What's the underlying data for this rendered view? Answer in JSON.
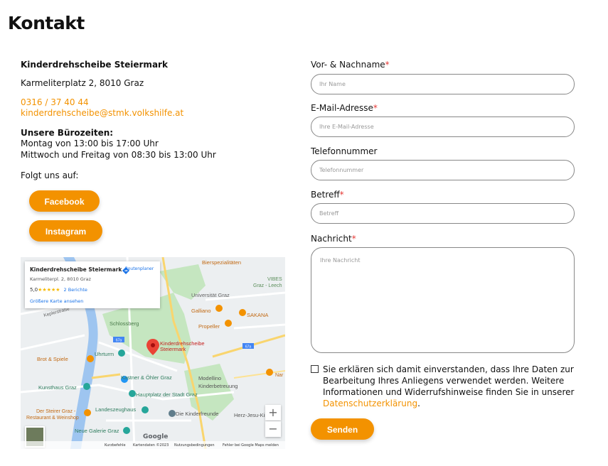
{
  "page": {
    "title": "Kontakt"
  },
  "contact": {
    "org": "Kinderdrehscheibe Steiermark",
    "address": "Karmeliterplatz 2, 8010 Graz",
    "phone": "0316 / 37 40 44",
    "email": "kinderdrehscheibe@stmk.volkshilfe.at",
    "hours_heading": "Unsere Bürozeiten:",
    "hours_line1": "Montag von 13:00 bis 17:00 Uhr",
    "hours_line2": "Mittwoch und Freitag von 08:30 bis 13:00 Uhr",
    "follow": "Folgt uns auf:",
    "facebook": "Facebook",
    "instagram": "Instagram"
  },
  "map": {
    "card_name": "Kinderdrehscheibe Steiermark",
    "card_address": "Karmeliterpl. 2, 8010 Graz",
    "rating": "5,0",
    "stars": "★★★★★",
    "reviews": "2 Berichte",
    "larger_map": "Größere Karte ansehen",
    "route": "Routenplaner",
    "zoom_in": "+",
    "zoom_out": "−",
    "pin_label": "Kinderdrehscheibe Steiermark",
    "places": [
      "Bierspezialitäten",
      "Universität Graz",
      "VIBES Graz - Leech",
      "Galliano",
      "SAKANA",
      "Propeller",
      "Keplerstraße",
      "Schlossberg",
      "Uhrturm",
      "Brot & Spiele",
      "Kastner & Öhler Graz",
      "Hauptplatz der Stadt Graz",
      "Kunsthaus Graz",
      "Landeszeughaus",
      "Der Steirer Graz - Restaurant & Weinshop",
      "Die Kinderfreunde",
      "Modellino",
      "Kinderbetreuung",
      "Neue Galerie Graz",
      "Herz-Jesu-Kirche",
      "Nar"
    ],
    "road_numbers": [
      "67a",
      "67a"
    ],
    "google": "Google",
    "footer": [
      "Kurzbefehle",
      "Kartendaten ©2023",
      "Nutzungsbedingungen",
      "Fehler bei Google Maps melden"
    ]
  },
  "form": {
    "name_label": "Vor- & Nachname",
    "name_placeholder": "Ihr Name",
    "email_label": "E-Mail-Adresse",
    "email_placeholder": "Ihre E-Mail-Adresse",
    "phone_label": "Telefonnummer",
    "phone_placeholder": "Telefonnummer",
    "subject_label": "Betreff",
    "subject_placeholder": "Betreff",
    "message_label": "Nachricht",
    "message_placeholder": "Ihre Nachricht",
    "required_mark": "*",
    "consent_text": "Sie erklären sich damit einverstanden, dass Ihre Daten zur Bearbeitung Ihres Anliegens verwendet werden. Weitere Informationen und Widerrufshinweise finden Sie in unserer ",
    "privacy_link": "Datenschutzerklärung",
    "consent_end": ".",
    "send": "Senden"
  },
  "colors": {
    "accent": "#f39200",
    "required": "#e53935",
    "link_blue": "#1a73e8"
  }
}
